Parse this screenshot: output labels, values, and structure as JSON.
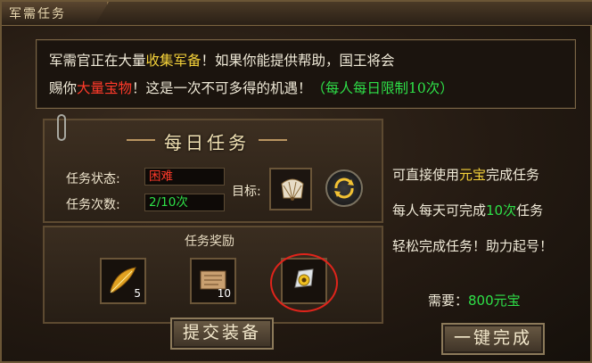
{
  "window": {
    "title": "军需任务"
  },
  "notice": {
    "line1": [
      {
        "text": "军需官正在大量",
        "color": "white"
      },
      {
        "text": "收集军备",
        "color": "yellow"
      },
      {
        "text": "！如果你能提供帮助，国王将会",
        "color": "white"
      }
    ],
    "line2": [
      {
        "text": "赐你",
        "color": "white"
      },
      {
        "text": "大量宝物",
        "color": "red"
      },
      {
        "text": "！这是一次不可多得的机遇！",
        "color": "white"
      },
      {
        "text": "（每人每日限制10次）",
        "color": "green"
      }
    ]
  },
  "task": {
    "title": "每日任务",
    "status_label": "任务状态:",
    "status_value": "困难",
    "count_label": "任务次数:",
    "count_value": "2/10次",
    "target_label": "目标:",
    "target_icon": "fan-icon",
    "refresh_icon": "refresh-icon"
  },
  "reward": {
    "title": "任务奖励",
    "items": [
      {
        "icon": "golden-feather-icon",
        "count": "5"
      },
      {
        "icon": "scroll-icon",
        "count": "10"
      },
      {
        "icon": "badge-icon",
        "count": ""
      }
    ],
    "submit_label": "提交装备"
  },
  "info": {
    "line1_pre": "可直接使用",
    "line1_hl": "元宝",
    "line1_post": "完成任务",
    "line2_pre": "每人每天可完成",
    "line2_hl": "10次",
    "line2_post": "任务",
    "line3": "轻松完成任务！助力起号！",
    "cost_label": "需要：",
    "cost_value": "800元宝",
    "complete_label": "一键完成"
  },
  "colors": {
    "yellow": "#f5d23a",
    "red": "#ff3a2a",
    "green": "#2ee048"
  }
}
